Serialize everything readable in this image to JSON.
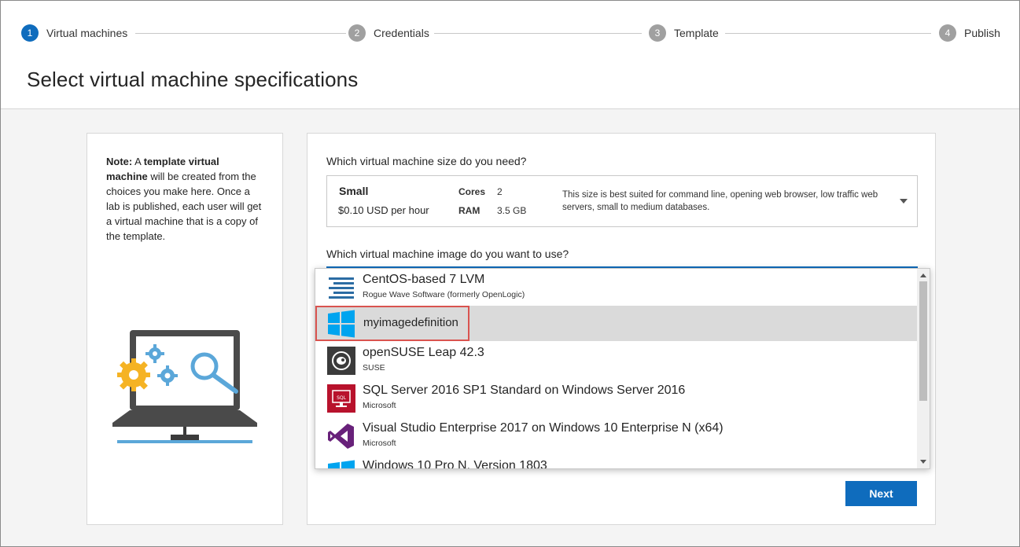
{
  "stepper": {
    "steps": [
      {
        "num": "1",
        "label": "Virtual machines",
        "active": true
      },
      {
        "num": "2",
        "label": "Credentials",
        "active": false
      },
      {
        "num": "3",
        "label": "Template",
        "active": false
      },
      {
        "num": "4",
        "label": "Publish",
        "active": false
      }
    ]
  },
  "page": {
    "title": "Select virtual machine specifications"
  },
  "note": {
    "prefix": "Note:",
    "bold1": "template virtual machine",
    "text_a": " A ",
    "text_b": " will be created from the choices you make here. Once a lab is published, each user will get a virtual machine that is a copy of the template."
  },
  "size": {
    "question": "Which virtual machine size do you need?",
    "name": "Small",
    "price": "$0.10 USD per hour",
    "cores_label": "Cores",
    "cores_value": "2",
    "ram_label": "RAM",
    "ram_value": "3.5 GB",
    "description": "This size is best suited for command line, opening web browser, low traffic web servers, small to medium databases."
  },
  "image": {
    "question": "Which virtual machine image do you want to use?",
    "items": [
      {
        "title": "CentOS-based 7 LVM",
        "subtitle": "Rogue Wave Software (formerly OpenLogic)",
        "icon": "centos-icon"
      },
      {
        "title": "myimagedefinition",
        "subtitle": "",
        "icon": "windows-icon",
        "selected": true
      },
      {
        "title": "openSUSE Leap 42.3",
        "subtitle": "SUSE",
        "icon": "opensuse-icon"
      },
      {
        "title": "SQL Server 2016 SP1 Standard on Windows Server 2016",
        "subtitle": "Microsoft",
        "icon": "sql-server-icon"
      },
      {
        "title": "Visual Studio Enterprise 2017 on Windows 10 Enterprise N (x64)",
        "subtitle": "Microsoft",
        "icon": "visual-studio-icon"
      },
      {
        "title": "Windows 10 Pro N, Version 1803",
        "subtitle": "",
        "icon": "windows-icon"
      }
    ]
  },
  "actions": {
    "next_label": "Next"
  },
  "colors": {
    "accent": "#0f6cbd",
    "highlight_border": "#d9534f",
    "selected_row": "#dadada"
  }
}
